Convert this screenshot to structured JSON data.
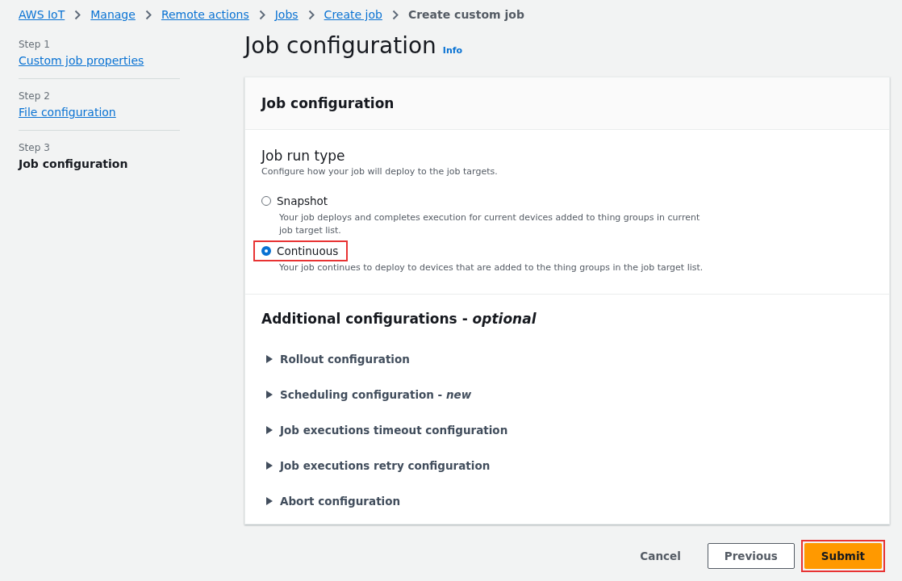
{
  "breadcrumbs": [
    {
      "label": "AWS IoT",
      "link": true
    },
    {
      "label": "Manage",
      "link": true
    },
    {
      "label": "Remote actions",
      "link": true
    },
    {
      "label": "Jobs",
      "link": true
    },
    {
      "label": "Create job",
      "link": true
    },
    {
      "label": "Create custom job",
      "link": false
    }
  ],
  "steps": [
    {
      "step": "Step 1",
      "label": "Custom job properties",
      "current": false
    },
    {
      "step": "Step 2",
      "label": "File configuration",
      "current": false
    },
    {
      "step": "Step 3",
      "label": "Job configuration",
      "current": true
    }
  ],
  "page_title": "Job configuration",
  "info_link": "Info",
  "panel": {
    "title": "Job configuration",
    "run_type": {
      "title": "Job run type",
      "description": "Configure how your job will deploy to the job targets.",
      "options": [
        {
          "label": "Snapshot",
          "description": "Your job deploys and completes execution for current devices added to thing groups in current job target list.",
          "selected": false,
          "highlighted": false
        },
        {
          "label": "Continuous",
          "description": "Your job continues to deploy to devices that are added to the thing groups in the job target list.",
          "selected": true,
          "highlighted": true
        }
      ]
    },
    "additional": {
      "title": "Additional configurations - *optional*",
      "sections": [
        {
          "label": "Rollout configuration",
          "expanded": false
        },
        {
          "label": "Scheduling configuration - *new*",
          "expanded": false
        },
        {
          "label": "Job executions timeout configuration",
          "expanded": false
        },
        {
          "label": "Job executions retry configuration",
          "expanded": false
        },
        {
          "label": "Abort configuration",
          "expanded": false
        }
      ]
    }
  },
  "buttons": [
    {
      "label": "Cancel",
      "kind": "link",
      "highlighted": false
    },
    {
      "label": "Previous",
      "kind": "normal",
      "highlighted": false
    },
    {
      "label": "Submit",
      "kind": "primary",
      "highlighted": true
    }
  ]
}
